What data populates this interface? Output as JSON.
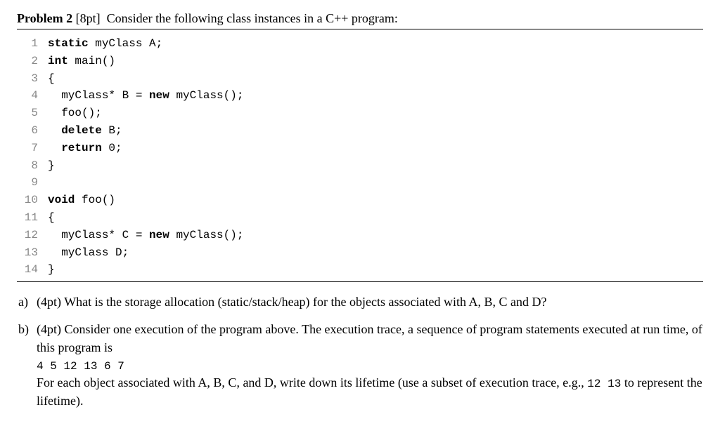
{
  "header": {
    "label": "Problem 2",
    "points": "[8pt]",
    "intro": "Consider the following class instances in a C++ program:"
  },
  "code": {
    "lines": [
      {
        "n": "1",
        "indent": "",
        "pre": "",
        "kw": "static",
        "post": " myClass A;"
      },
      {
        "n": "2",
        "indent": "",
        "pre": "",
        "kw": "int",
        "post": " main()"
      },
      {
        "n": "3",
        "indent": "",
        "pre": "{",
        "kw": "",
        "post": ""
      },
      {
        "n": "4",
        "indent": "  ",
        "pre": "myClass* B = ",
        "kw": "new",
        "post": " myClass();"
      },
      {
        "n": "5",
        "indent": "  ",
        "pre": "foo();",
        "kw": "",
        "post": ""
      },
      {
        "n": "6",
        "indent": "  ",
        "pre": "",
        "kw": "delete",
        "post": " B;"
      },
      {
        "n": "7",
        "indent": "  ",
        "pre": "",
        "kw": "return",
        "post": " 0;"
      },
      {
        "n": "8",
        "indent": "",
        "pre": "}",
        "kw": "",
        "post": ""
      },
      {
        "n": "9",
        "indent": "",
        "pre": "",
        "kw": "",
        "post": ""
      },
      {
        "n": "10",
        "indent": "",
        "pre": "",
        "kw": "void",
        "post": " foo()"
      },
      {
        "n": "11",
        "indent": "",
        "pre": "{",
        "kw": "",
        "post": ""
      },
      {
        "n": "12",
        "indent": "  ",
        "pre": "myClass* C = ",
        "kw": "new",
        "post": " myClass();"
      },
      {
        "n": "13",
        "indent": "  ",
        "pre": "myClass D;",
        "kw": "",
        "post": ""
      },
      {
        "n": "14",
        "indent": "",
        "pre": "}",
        "kw": "",
        "post": ""
      }
    ]
  },
  "qa": {
    "label": "a)",
    "points": "(4pt)",
    "text": "What is the storage allocation (static/stack/heap) for the objects associated with A, B, C and D?"
  },
  "qb": {
    "label": "b)",
    "points": "(4pt)",
    "text1": "Consider one execution of the program above. The execution trace, a sequence of program statements executed at run time, of this program is",
    "trace": "4  5  12  13  6  7",
    "text2a": "For each object associated with A, B, C, and D, write down its lifetime (use a subset of execution trace, e.g., ",
    "example": "12  13",
    "text2b": " to represent the lifetime)."
  }
}
